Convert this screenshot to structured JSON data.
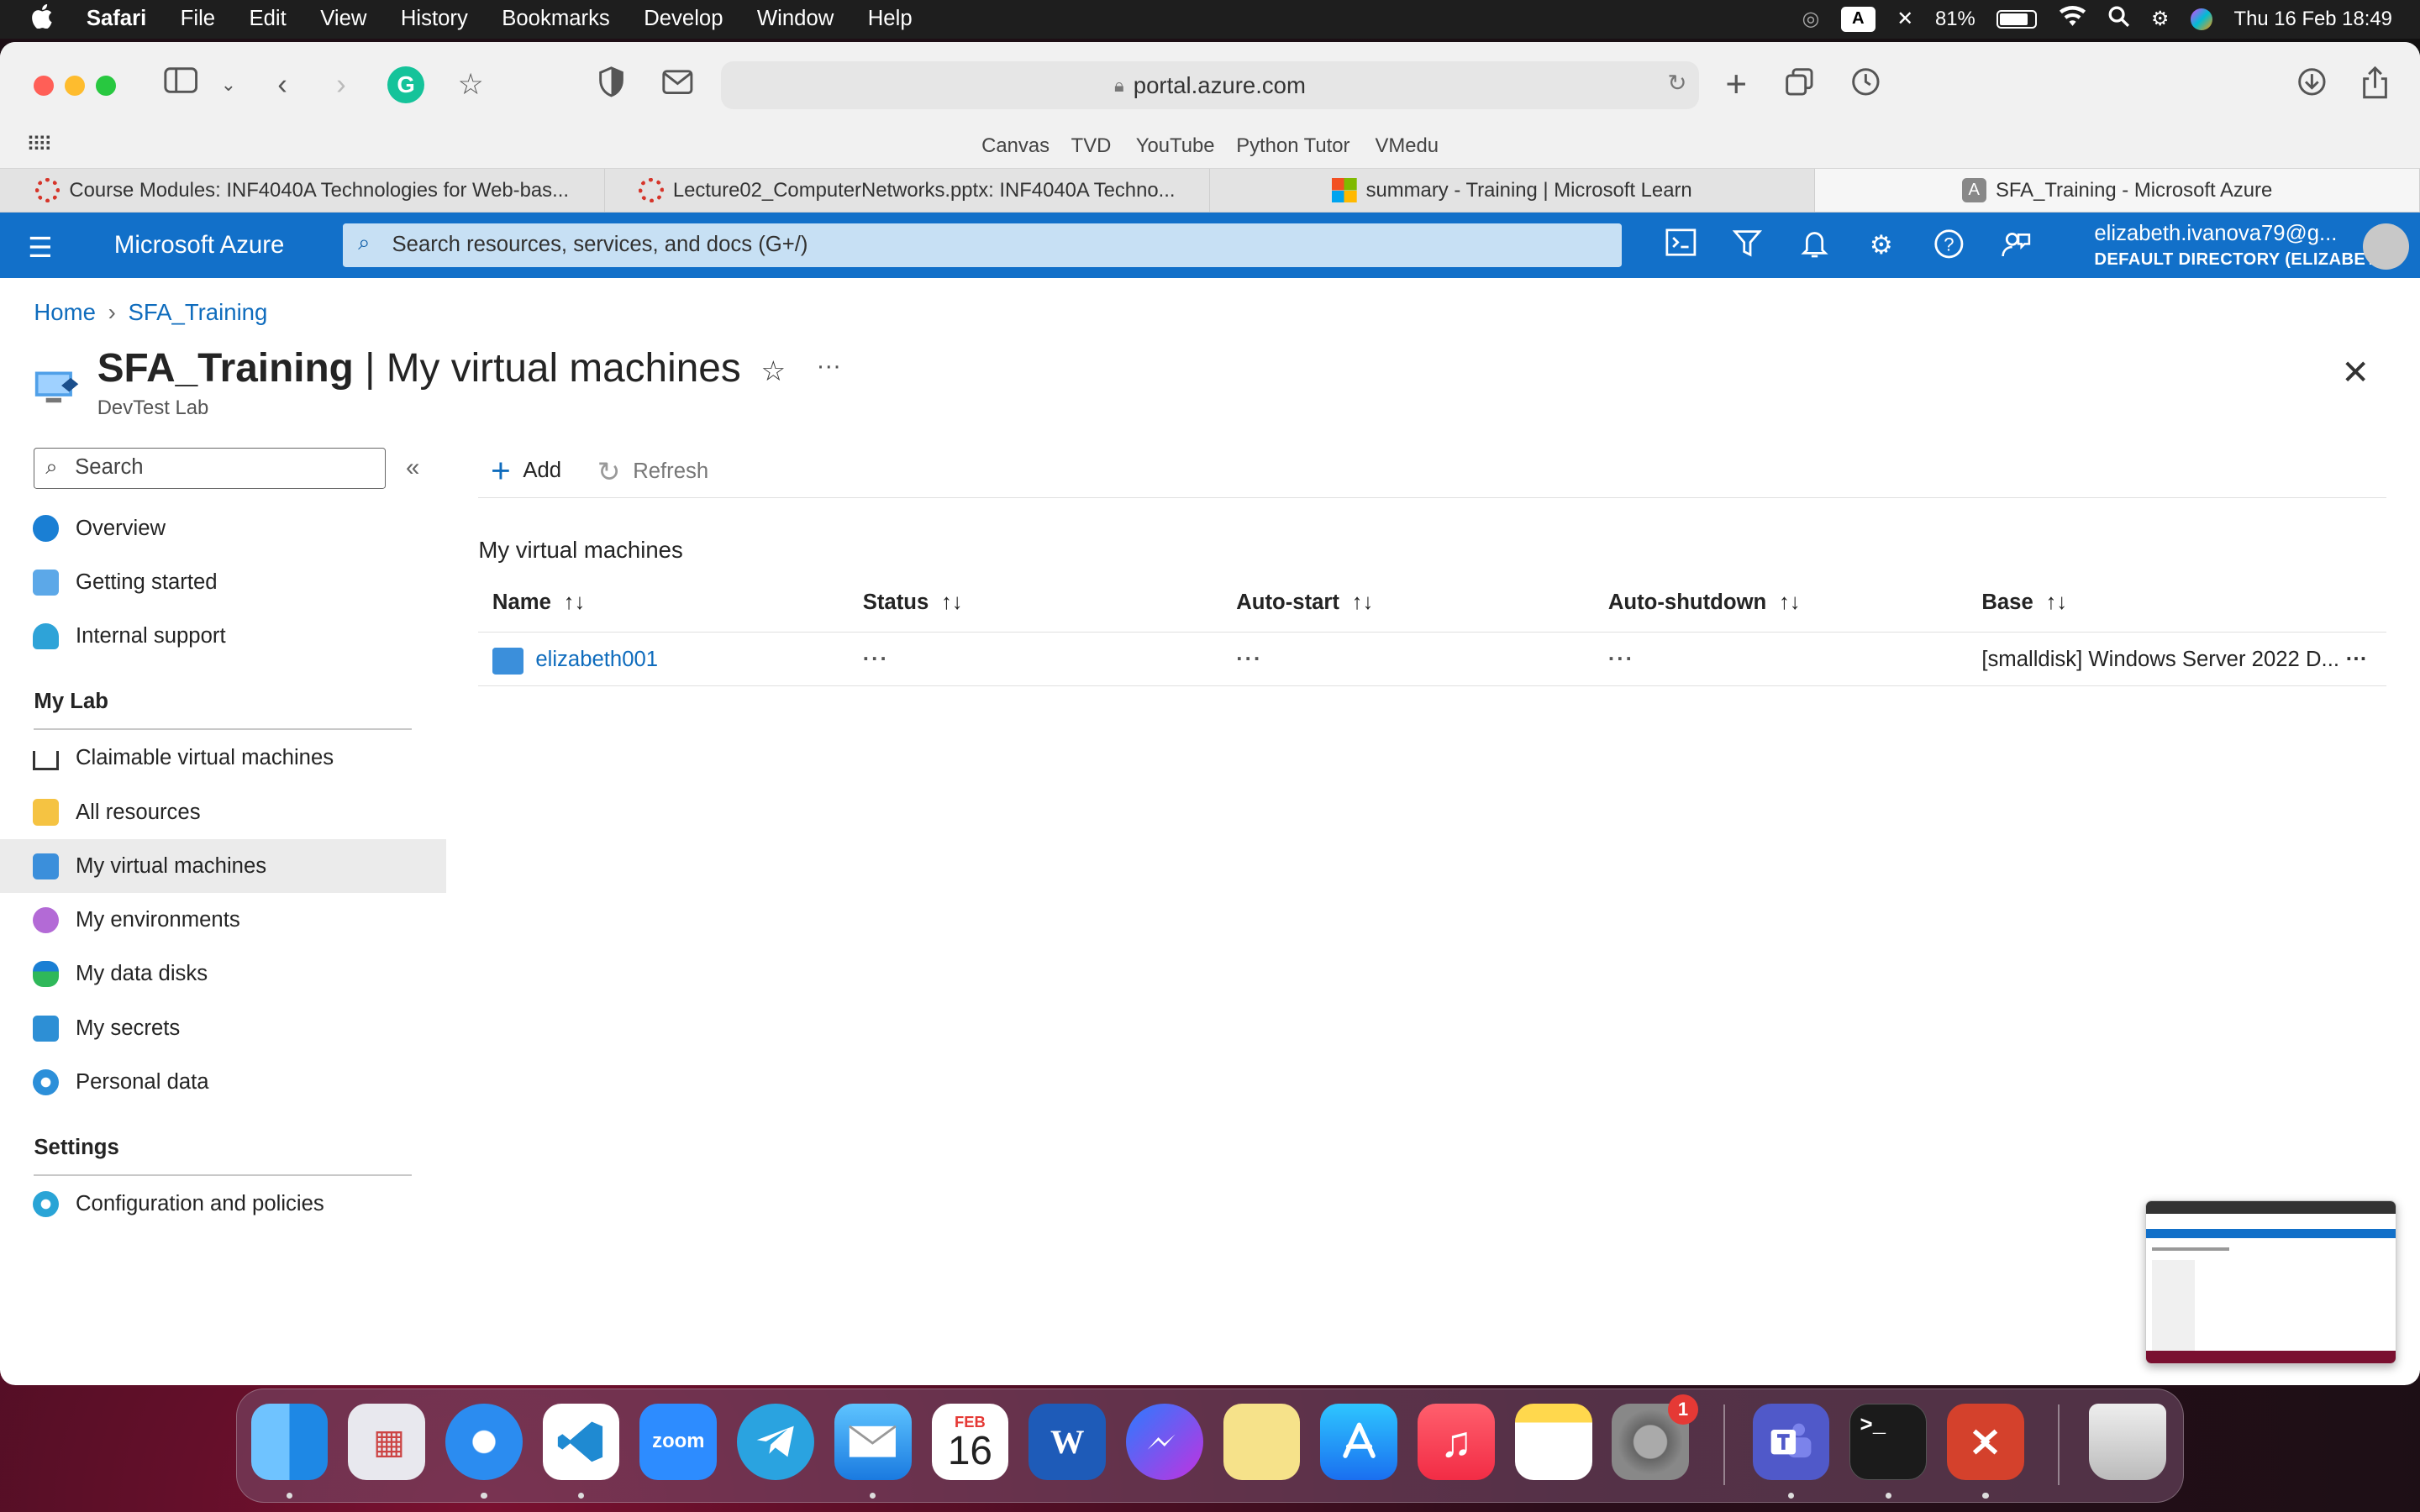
{
  "menubar": {
    "app": "Safari",
    "items": [
      "File",
      "Edit",
      "View",
      "History",
      "Bookmarks",
      "Develop",
      "Window",
      "Help"
    ],
    "input_source": "A",
    "battery": "81%",
    "clock": "Thu 16 Feb  18:49"
  },
  "browser": {
    "url": "portal.azure.com",
    "favorites": [
      "Canvas",
      "TVD",
      "YouTube",
      "Python Tutor",
      "VMedu"
    ],
    "tabs": [
      {
        "title": "Course Modules: INF4040A Technologies for Web-bas..."
      },
      {
        "title": "Lecture02_ComputerNetworks.pptx: INF4040A Techno..."
      },
      {
        "title": "summary - Training | Microsoft Learn"
      },
      {
        "title": "SFA_Training - Microsoft Azure"
      }
    ]
  },
  "azure": {
    "brand": "Microsoft Azure",
    "search_placeholder": "Search resources, services, and docs (G+/)",
    "user_email": "elizabeth.ivanova79@g...",
    "user_directory": "DEFAULT DIRECTORY (ELIZABET..."
  },
  "breadcrumb": [
    "Home",
    "SFA_Training"
  ],
  "page": {
    "title_bold": "SFA_Training",
    "title_rest": " | My virtual machines",
    "subtitle": "DevTest Lab"
  },
  "sidebar": {
    "search_placeholder": "Search",
    "top_items": [
      "Overview",
      "Getting started",
      "Internal support"
    ],
    "section_mylab": "My Lab",
    "mylab_items": [
      "Claimable virtual machines",
      "All resources",
      "My virtual machines",
      "My environments",
      "My data disks",
      "My secrets",
      "Personal data"
    ],
    "section_settings": "Settings",
    "settings_items": [
      "Configuration and policies"
    ]
  },
  "commands": {
    "add": "Add",
    "refresh": "Refresh"
  },
  "list": {
    "title": "My virtual machines",
    "columns": [
      "Name",
      "Status",
      "Auto-start",
      "Auto-shutdown",
      "Base"
    ],
    "rows": [
      {
        "name": "elizabeth001",
        "status": "···",
        "auto_start": "···",
        "auto_shutdown": "···",
        "base": "[smalldisk] Windows Server 2022 D..."
      }
    ]
  },
  "dock": {
    "calendar_month": "FEB",
    "calendar_day": "16",
    "settings_badge": "1",
    "zoom_label": "zoom",
    "word_label": "W"
  },
  "colors": {
    "azure_blue": "#1270c9",
    "link": "#0f6cbd"
  }
}
